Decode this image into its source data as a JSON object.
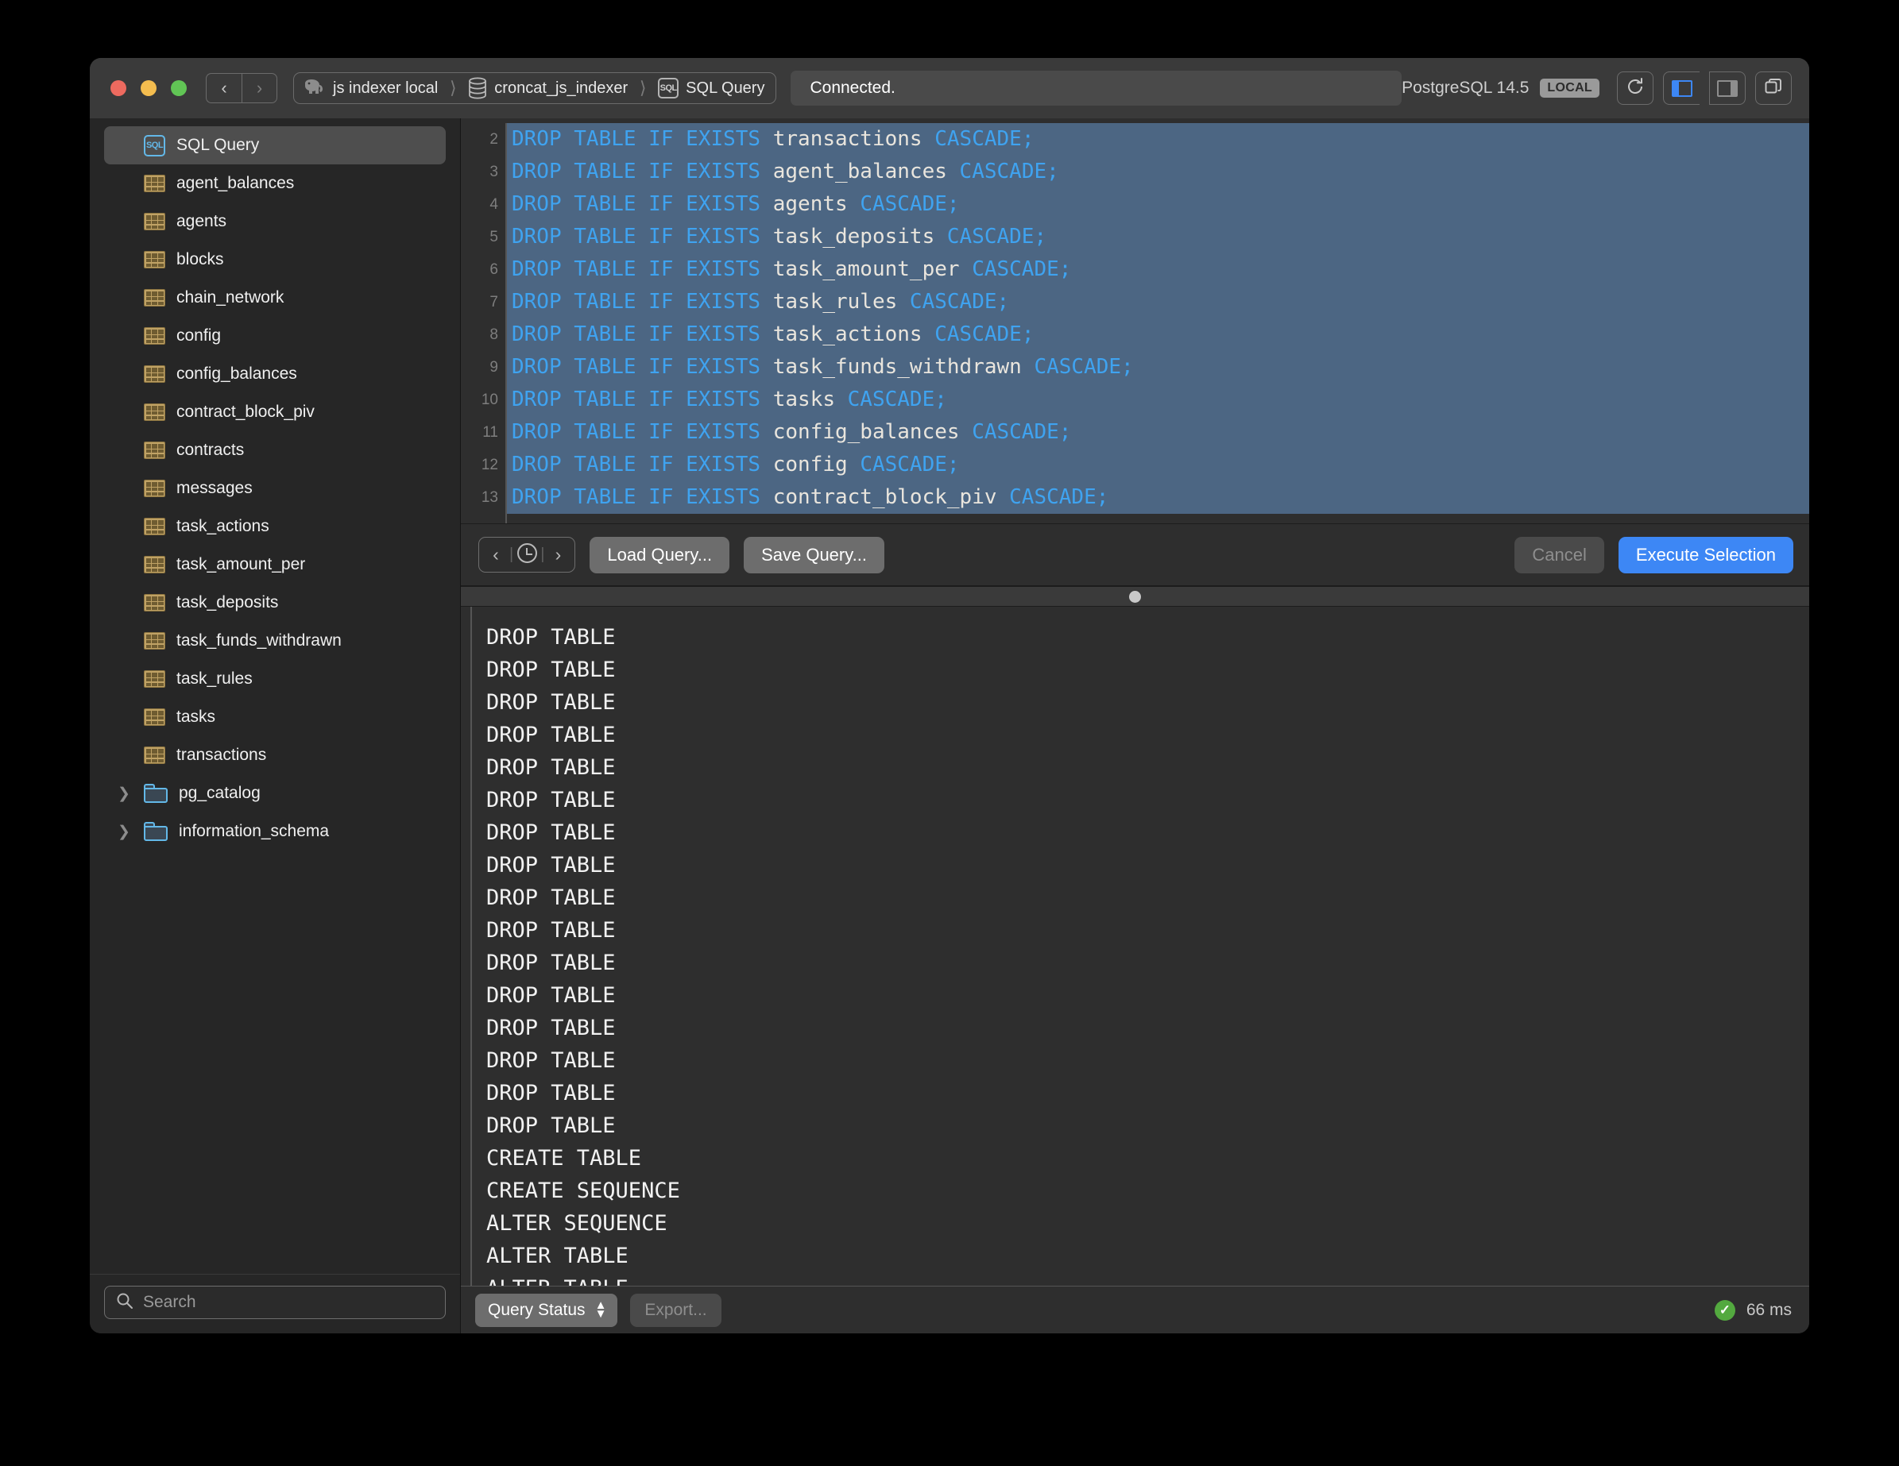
{
  "window": {
    "traffic_lights": [
      "close",
      "minimize",
      "zoom"
    ],
    "nav_back": "‹",
    "nav_forward": "›",
    "breadcrumb": [
      {
        "icon": "elephant-icon",
        "label": "js indexer local"
      },
      {
        "icon": "database-icon",
        "label": "croncat_js_indexer"
      },
      {
        "icon": "sql-icon",
        "label": "SQL Query"
      }
    ],
    "status": "Connected.",
    "server_version": "PostgreSQL 14.5",
    "server_badge": "LOCAL",
    "toolbar_icons": [
      "refresh-icon",
      "left-sidebar-toggle-icon",
      "right-sidebar-toggle-icon",
      "window-tabs-icon"
    ]
  },
  "sidebar": {
    "items": [
      {
        "label": "SQL Query",
        "icon": "sql-icon",
        "selected": true,
        "type": "query"
      },
      {
        "label": "agent_balances",
        "icon": "table-icon",
        "type": "table"
      },
      {
        "label": "agents",
        "icon": "table-icon",
        "type": "table"
      },
      {
        "label": "blocks",
        "icon": "table-icon",
        "type": "table"
      },
      {
        "label": "chain_network",
        "icon": "table-icon",
        "type": "table"
      },
      {
        "label": "config",
        "icon": "table-icon",
        "type": "table"
      },
      {
        "label": "config_balances",
        "icon": "table-icon",
        "type": "table"
      },
      {
        "label": "contract_block_piv",
        "icon": "table-icon",
        "type": "table"
      },
      {
        "label": "contracts",
        "icon": "table-icon",
        "type": "table"
      },
      {
        "label": "messages",
        "icon": "table-icon",
        "type": "table"
      },
      {
        "label": "task_actions",
        "icon": "table-icon",
        "type": "table"
      },
      {
        "label": "task_amount_per",
        "icon": "table-icon",
        "type": "table"
      },
      {
        "label": "task_deposits",
        "icon": "table-icon",
        "type": "table"
      },
      {
        "label": "task_funds_withdrawn",
        "icon": "table-icon",
        "type": "table"
      },
      {
        "label": "task_rules",
        "icon": "table-icon",
        "type": "table"
      },
      {
        "label": "tasks",
        "icon": "table-icon",
        "type": "table"
      },
      {
        "label": "transactions",
        "icon": "table-icon",
        "type": "table"
      },
      {
        "label": "pg_catalog",
        "icon": "folder-icon",
        "type": "folder",
        "expanded": false
      },
      {
        "label": "information_schema",
        "icon": "folder-icon",
        "type": "folder",
        "expanded": false
      }
    ],
    "search_placeholder": "Search",
    "search_value": ""
  },
  "editor": {
    "lines": [
      {
        "num": "2",
        "table": "transactions"
      },
      {
        "num": "3",
        "table": "agent_balances"
      },
      {
        "num": "4",
        "table": "agents"
      },
      {
        "num": "5",
        "table": "task_deposits"
      },
      {
        "num": "6",
        "table": "task_amount_per"
      },
      {
        "num": "7",
        "table": "task_rules"
      },
      {
        "num": "8",
        "table": "task_actions"
      },
      {
        "num": "9",
        "table": "task_funds_withdrawn"
      },
      {
        "num": "10",
        "table": "tasks"
      },
      {
        "num": "11",
        "table": "config_balances"
      },
      {
        "num": "12",
        "table": "config"
      },
      {
        "num": "13",
        "table": "contract_block_piv"
      }
    ],
    "keyword_prefix": "DROP TABLE IF EXISTS",
    "keyword_suffix": "CASCADE",
    "terminator": ";",
    "selection_color": "#4c6683",
    "keyword_color": "#3fa3f0",
    "identifier_color": "#e9e5dd"
  },
  "editor_toolbar": {
    "history_prev": "‹",
    "history_clock": "clock-icon",
    "history_next": "›",
    "load_query": "Load Query...",
    "save_query": "Save Query...",
    "cancel": "Cancel",
    "execute": "Execute Selection",
    "execute_color": "#3d87f5"
  },
  "results": {
    "rows": [
      "DROP TABLE",
      "DROP TABLE",
      "DROP TABLE",
      "DROP TABLE",
      "DROP TABLE",
      "DROP TABLE",
      "DROP TABLE",
      "DROP TABLE",
      "DROP TABLE",
      "DROP TABLE",
      "DROP TABLE",
      "DROP TABLE",
      "DROP TABLE",
      "DROP TABLE",
      "DROP TABLE",
      "DROP TABLE",
      "CREATE TABLE",
      "CREATE SEQUENCE",
      "ALTER SEQUENCE",
      "ALTER TABLE",
      "ALTER TABLE"
    ]
  },
  "statusbar": {
    "popup_label": "Query Status",
    "export_label": "Export...",
    "status_icon": "success-check-icon",
    "duration": "66 ms",
    "success_color": "#53a93f"
  }
}
